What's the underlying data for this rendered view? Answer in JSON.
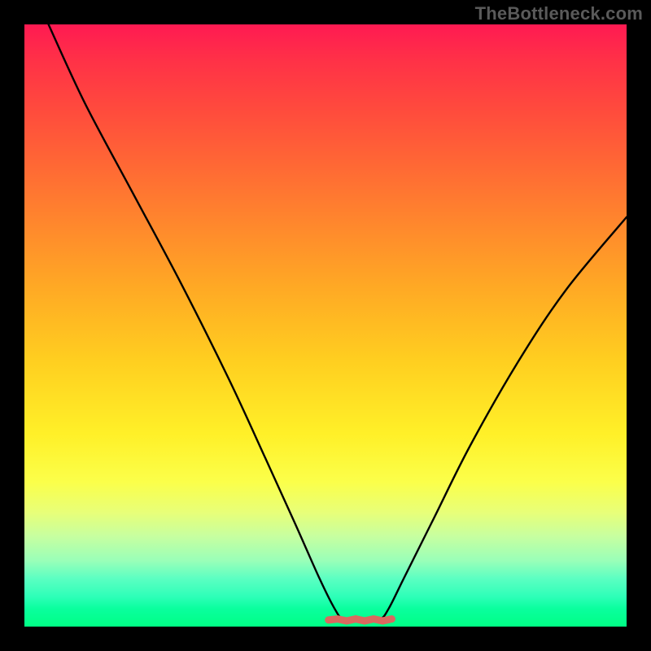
{
  "watermark": "TheBottleneck.com",
  "chart_data": {
    "type": "line",
    "title": "",
    "xlabel": "",
    "ylabel": "",
    "xlim": [
      0,
      100
    ],
    "ylim": [
      0,
      100
    ],
    "note": "Axes are implicit (no ticks/labels shown). y=0 is bottom (green), y=100 is top (red). Curve shows a V-shaped dip reaching ~0 near x≈52–60, with a short flat red band at the trough.",
    "series": [
      {
        "name": "curve",
        "x": [
          4,
          10,
          18,
          26,
          34,
          40,
          45,
          49,
          51.5,
          53,
          56,
          59,
          60.5,
          63,
          68,
          74,
          82,
          90,
          100
        ],
        "y": [
          100,
          87,
          72,
          57,
          41,
          28,
          17,
          8,
          3,
          1.2,
          1.0,
          1.2,
          3,
          8,
          18,
          30,
          44,
          56,
          68
        ]
      }
    ],
    "trough_band": {
      "x_start": 50.5,
      "x_end": 61,
      "y": 1.1,
      "color": "#d9695f"
    },
    "gradient_stops": [
      {
        "pos": 0,
        "color": "#ff1a52"
      },
      {
        "pos": 24,
        "color": "#ff6a34"
      },
      {
        "pos": 56,
        "color": "#ffcf20"
      },
      {
        "pos": 76,
        "color": "#fbff4a"
      },
      {
        "pos": 100,
        "color": "#00ff85"
      }
    ]
  }
}
